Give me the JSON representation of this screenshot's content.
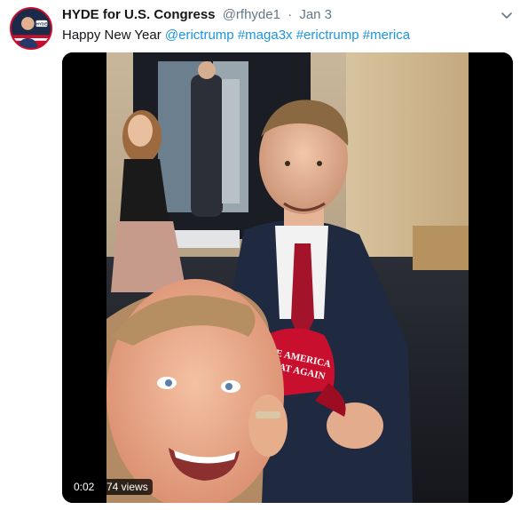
{
  "tweet": {
    "author_name": "HYDE for U.S. Congress",
    "handle": "@rfhyde1",
    "separator": "·",
    "date": "Jan 3",
    "text_prefix": "Happy New Year ",
    "links": [
      "@erictrump",
      "#maga3x",
      "#erictrump",
      "#merica"
    ],
    "avatar_icon": "profile-avatar",
    "menu_icon": "chevron-down-icon"
  },
  "video": {
    "elapsed": "0:02",
    "views": "74 views",
    "hat_text_line1": "MAKE AMERICA",
    "hat_text_line2": "GREAT AGAIN"
  },
  "colors": {
    "link": "#1b95e0",
    "secondary_text": "#657786",
    "primary_text": "#14171a",
    "hat_red": "#c8102e"
  }
}
